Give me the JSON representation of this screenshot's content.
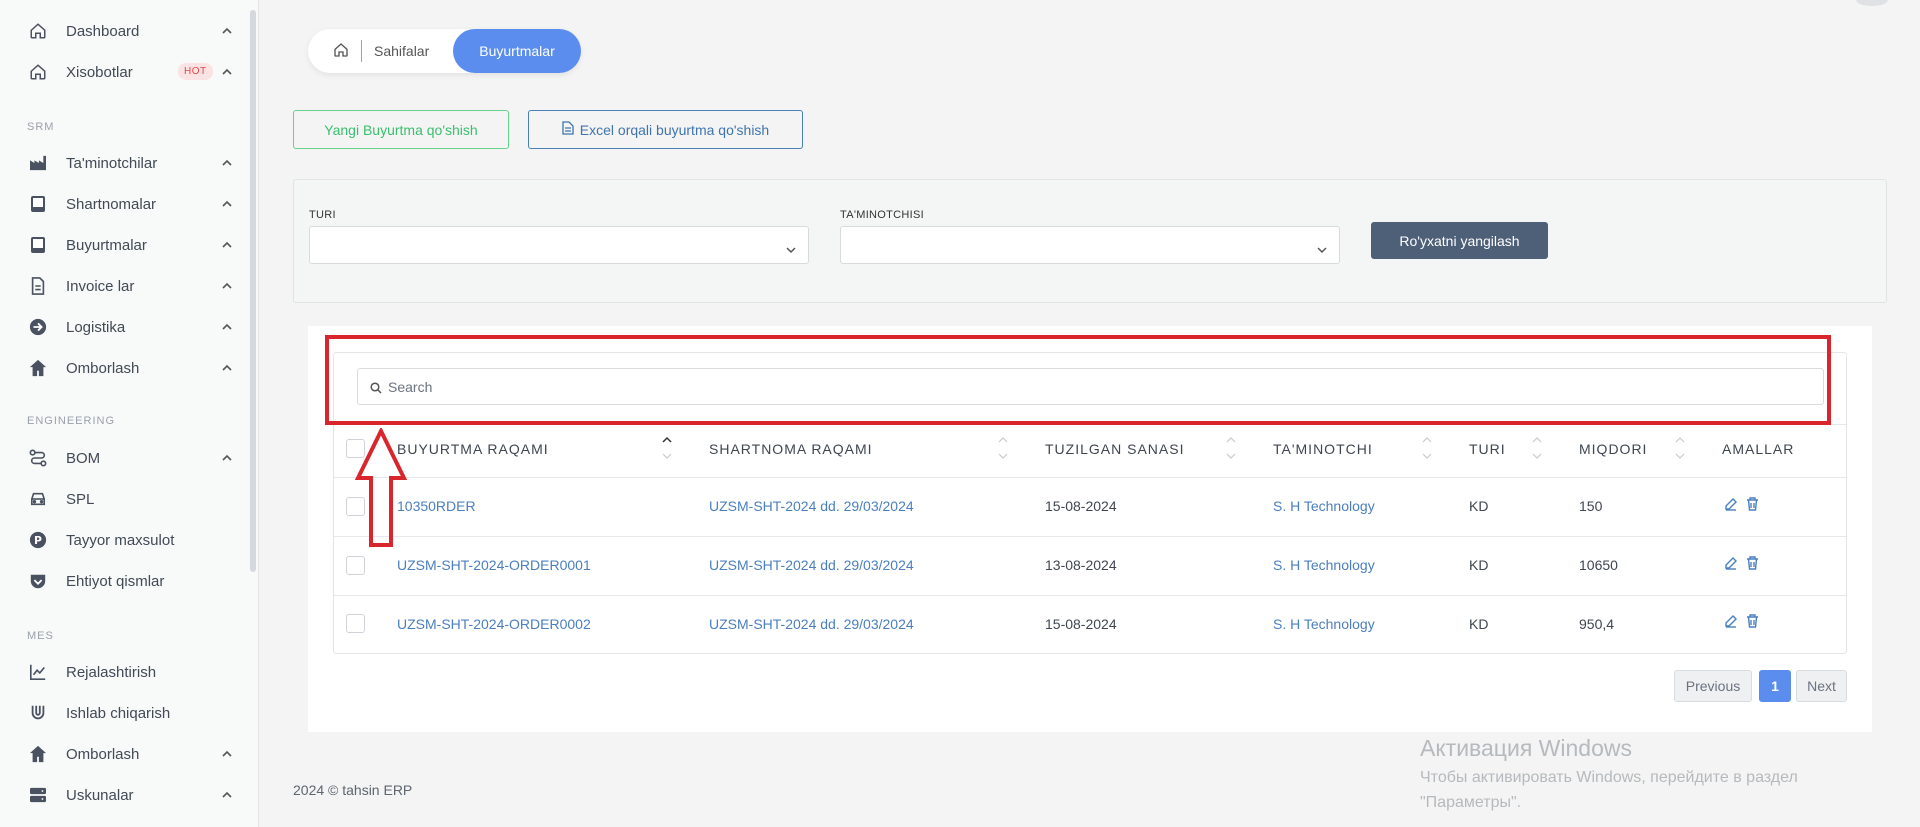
{
  "sidebar": {
    "items_top": [
      {
        "label": "Dashboard",
        "icon": "home-icon"
      },
      {
        "label": "Xisobotlar",
        "icon": "home-icon",
        "badge": "HOT"
      }
    ],
    "sections": [
      {
        "title": "SRM",
        "items": [
          {
            "label": "Ta'minotchilar",
            "icon": "factory-icon"
          },
          {
            "label": "Shartnomalar",
            "icon": "book-icon"
          },
          {
            "label": "Buyurtmalar",
            "icon": "book-icon"
          },
          {
            "label": "Invoice lar",
            "icon": "document-icon"
          },
          {
            "label": "Logistika",
            "icon": "arrow-circle-icon"
          },
          {
            "label": "Omborlash",
            "icon": "house-icon"
          }
        ]
      },
      {
        "title": "ENGINEERING",
        "items": [
          {
            "label": "BOM",
            "icon": "route-icon"
          },
          {
            "label": "SPL",
            "icon": "car-icon"
          },
          {
            "label": "Tayyor maxsulot",
            "icon": "p-circle-icon"
          },
          {
            "label": "Ehtiyot qismlar",
            "icon": "shield-check-icon"
          }
        ]
      },
      {
        "title": "MES",
        "items": [
          {
            "label": "Rejalashtirish",
            "icon": "chart-line-icon"
          },
          {
            "label": "Ishlab chiqarish",
            "icon": "magnet-icon"
          },
          {
            "label": "Omborlash",
            "icon": "house-icon"
          },
          {
            "label": "Uskunalar",
            "icon": "server-icon"
          }
        ]
      }
    ]
  },
  "breadcrumb": {
    "link": "Sahifalar",
    "active": "Buyurtmalar"
  },
  "actions": {
    "new_order": "Yangi Buyurtma qo'shish",
    "excel_order": "Excel orqali buyurtma qo'shish"
  },
  "filters": {
    "type_label": "TURI",
    "supplier_label": "TA'MINOTCHISI",
    "type_value": "",
    "supplier_value": "",
    "refresh_button": "Ro'yxatni yangilash"
  },
  "search": {
    "placeholder": "Search"
  },
  "table": {
    "headers": [
      "BUYURTMA RAQAMI",
      "SHARTNOMA RAQAMI",
      "TUZILGAN SANASI",
      "TA'MINOTCHI",
      "TURI",
      "MIQDORI",
      "AMALLAR"
    ],
    "rows": [
      {
        "order": "10350RDER",
        "contract": "UZSM-SHT-2024 dd. 29/03/2024",
        "date": "15-08-2024",
        "supplier": "S. H Technology",
        "type": "KD",
        "qty": "150"
      },
      {
        "order": "UZSM-SHT-2024-ORDER0001",
        "contract": "UZSM-SHT-2024 dd. 29/03/2024",
        "date": "13-08-2024",
        "supplier": "S. H Technology",
        "type": "KD",
        "qty": "10650"
      },
      {
        "order": "UZSM-SHT-2024-ORDER0002",
        "contract": "UZSM-SHT-2024 dd. 29/03/2024",
        "date": "15-08-2024",
        "supplier": "S. H Technology",
        "type": "KD",
        "qty": "950,4"
      }
    ]
  },
  "pagination": {
    "previous": "Previous",
    "current": "1",
    "next": "Next"
  },
  "footer": "2024 © tahsin ERP",
  "watermark": {
    "title": "Активация Windows",
    "line1": "Чтобы активировать Windows, перейдите в раздел",
    "line2": "\"Параметры\"."
  },
  "colors": {
    "accent": "#5b8def",
    "annotation": "#d9262c",
    "link": "#4a7fc0",
    "success": "#3bbf6e"
  }
}
